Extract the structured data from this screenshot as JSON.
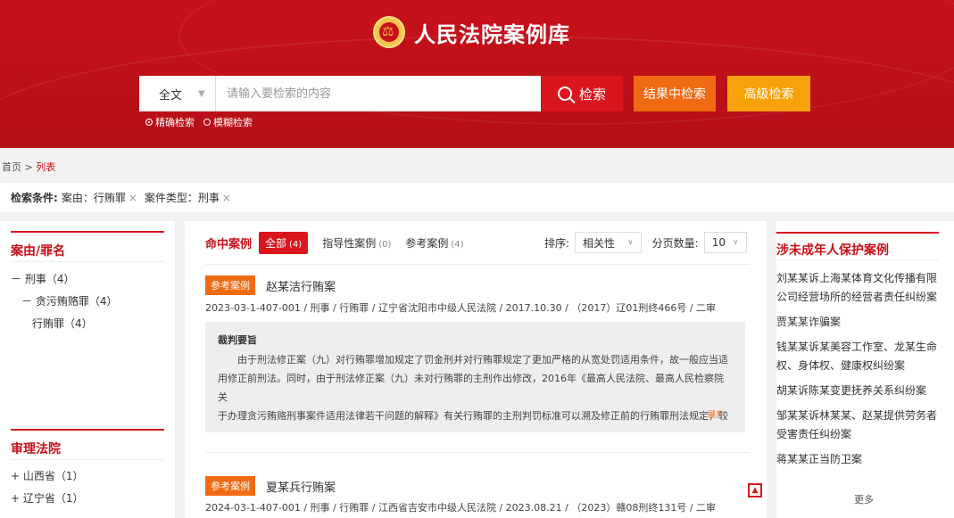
{
  "header": {
    "site_title": "人民法院案例库",
    "scope": "全文",
    "search_placeholder": "请输入要检索的内容",
    "search_label": "检索",
    "within_label": "结果中检索",
    "advanced_label": "高级检索",
    "mode_exact": "精确检索",
    "mode_fuzzy": "模糊检索"
  },
  "breadcrumb": {
    "home": "首页",
    "sep": " > ",
    "current": "列表"
  },
  "conditions": {
    "label": "检索条件:",
    "items": [
      "案由：行贿罪",
      "案件类型：刑事"
    ],
    "remove_glyph": "×"
  },
  "left": {
    "cause_title": "案由/罪名",
    "cause_tree": [
      "－ 刑事（4）",
      "－ 贪污贿赂罪（4）",
      "行贿罪（4）"
    ],
    "court_title": "审理法院",
    "court_tree": [
      "+ 山西省（1）",
      "+ 辽宁省（1）"
    ]
  },
  "main": {
    "hit_label": "命中案例",
    "tab_all": "全部",
    "tab_all_count": "(4)",
    "tab_guiding": "指导性案例",
    "tab_guiding_count": "(0)",
    "tab_reference": "参考案例",
    "tab_reference_count": "(4)",
    "sort_label": "排序:",
    "sort_value": "相关性",
    "page_size_label": "分页数量:",
    "page_size_value": "10",
    "cases": [
      {
        "tag": "参考案例",
        "title": "赵某洁行贿案",
        "meta": "2023-03-1-407-001 / 刑事 / 行贿罪 / 辽宁省沈阳市中级人民法院 / 2017.10.30 / （2017）辽01刑终466号 / 二审"
      },
      {
        "tag": "参考案例",
        "title": "夏某兵行贿案",
        "meta": "2024-03-1-407-001 / 刑事 / 行贿罪 / 江西省吉安市中级人民法院 / 2023.08.21 / （2023）赣08刑终131号 / 二审"
      }
    ],
    "abstract_heading": "裁判要旨",
    "abstract_lines": [
      "由于刑法修正案（九）对行贿罪增加规定了罚金刑并对行贿罪规定了更加严格的从宽处罚适用条件，故一般应当适",
      "用修正前刑法。同时，由于刑法修正案（九）未对行贿罪的主刑作出修改，2016年《最高人民法院、最高人民检察院关",
      "于办理贪污贿赂刑事案件适用法律若干问题的解释》有关行贿罪的主刑判罚标准可以溯及修正前的行贿罪刑法规定，较"
    ],
    "expand_label": "展开"
  },
  "right": {
    "title": "涉未成年人保护案例",
    "items": [
      "刘某某诉上海某体育文化传播有限公司经营场所的经营者责任纠纷案",
      "贾某某诈骗案",
      "钱某某诉某美容工作室、龙某生命权、身体权、健康权纠纷案",
      "胡某诉陈某变更抚养关系纠纷案",
      "邹某某诉林某某、赵某提供劳务者受害责任纠纷案",
      "蒋某某正当防卫案"
    ],
    "more_label": "更多"
  }
}
